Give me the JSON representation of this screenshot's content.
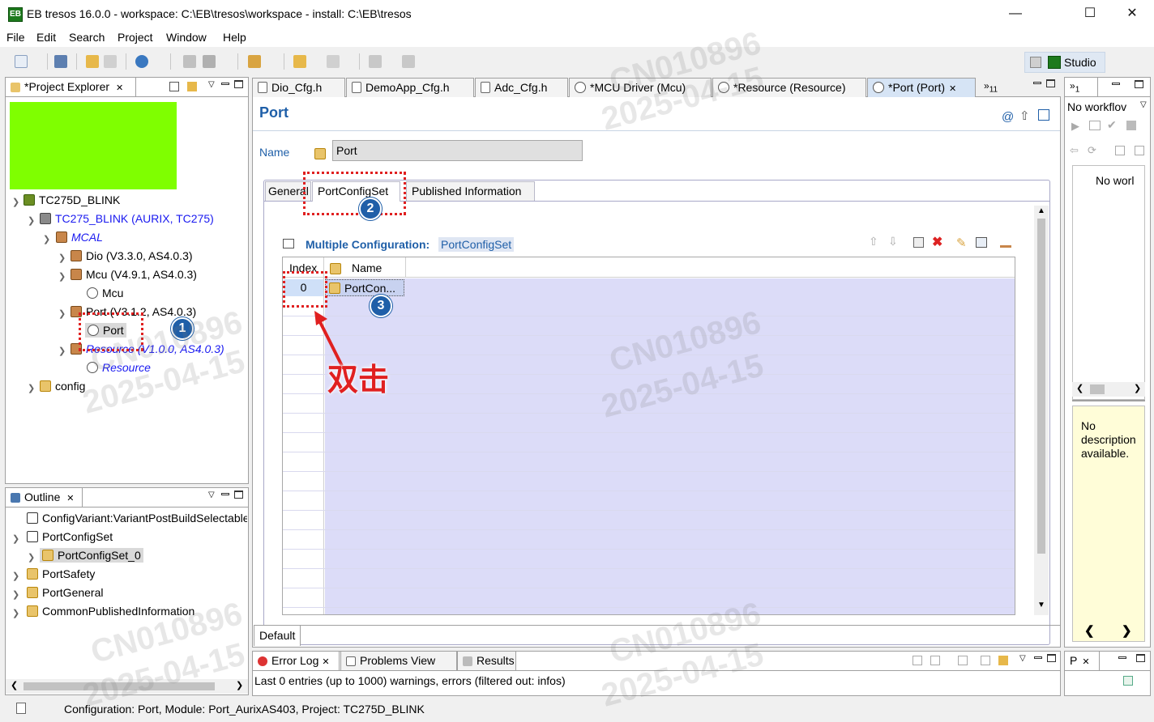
{
  "window": {
    "title": "EB tresos 16.0.0 - workspace: C:\\EB\\tresos\\workspace - install: C:\\EB\\tresos",
    "app_icon": "EB"
  },
  "menu": [
    "File",
    "Edit",
    "Search",
    "Project",
    "Window",
    "Help"
  ],
  "perspective": {
    "label": "Studio"
  },
  "project_explorer": {
    "tab_label": "*Project Explorer",
    "items": [
      {
        "label": "TC275D_BLINK"
      },
      {
        "label": "TC275_BLINK (AURIX, TC275)"
      },
      {
        "label": "MCAL"
      },
      {
        "label": "Dio (V3.3.0, AS4.0.3)"
      },
      {
        "label": "Mcu (V4.9.1, AS4.0.3)"
      },
      {
        "label": "Mcu"
      },
      {
        "label": "Port (V3.1.2, AS4.0.3)"
      },
      {
        "label": "Port"
      },
      {
        "label": "Resource (V1.0.0, AS4.0.3)"
      },
      {
        "label": "Resource"
      },
      {
        "label": "config"
      }
    ]
  },
  "outline": {
    "tab_label": "Outline",
    "items": [
      {
        "label": "ConfigVariant:VariantPostBuildSelectable"
      },
      {
        "label": "PortConfigSet"
      },
      {
        "label": "PortConfigSet_0"
      },
      {
        "label": "PortSafety"
      },
      {
        "label": "PortGeneral"
      },
      {
        "label": "CommonPublishedInformation"
      }
    ]
  },
  "editor_tabs": [
    {
      "label": "Dio_Cfg.h"
    },
    {
      "label": "DemoApp_Cfg.h"
    },
    {
      "label": "Adc_Cfg.h"
    },
    {
      "label": "*MCU Driver (Mcu)"
    },
    {
      "label": "*Resource (Resource)"
    },
    {
      "label": "*Port (Port)"
    }
  ],
  "editor_overflow": "11",
  "editor": {
    "title": "Port",
    "name_label": "Name",
    "name_value": "Port",
    "subtabs": [
      "General",
      "PortConfigSet",
      "Published Information"
    ],
    "multi_config_label": "Multiple Configuration:",
    "multi_config_value": "PortConfigSet",
    "columns": [
      "Index",
      "Name"
    ],
    "rows": [
      {
        "index": "0",
        "name": "PortCon..."
      }
    ],
    "bottom_tab": "Default"
  },
  "annotations": {
    "badge1": "1",
    "badge2": "2",
    "badge3": "3",
    "double_click": "双击"
  },
  "right_panel": {
    "top_tab": "1",
    "workflow_label": "No workflov",
    "list_text": "No worl",
    "description": "No description available."
  },
  "bottom_panel": {
    "tabs": [
      "Error Log",
      "Problems View",
      "Results"
    ],
    "status": "Last 0 entries (up to 1000) warnings, errors (filtered out: infos)"
  },
  "small_panel": {
    "tab": "P"
  },
  "statusbar": {
    "text": "Configuration: Port, Module: Port_AurixAS403, Project: TC275D_BLINK"
  },
  "watermark": {
    "id": "CN010896",
    "date": "2025-04-15"
  },
  "colors": {
    "accent_blue": "#1f5fa8",
    "grid_lavender": "#dcdcf8",
    "highlight_green": "#7fff00",
    "annotation_red": "#e02020"
  }
}
